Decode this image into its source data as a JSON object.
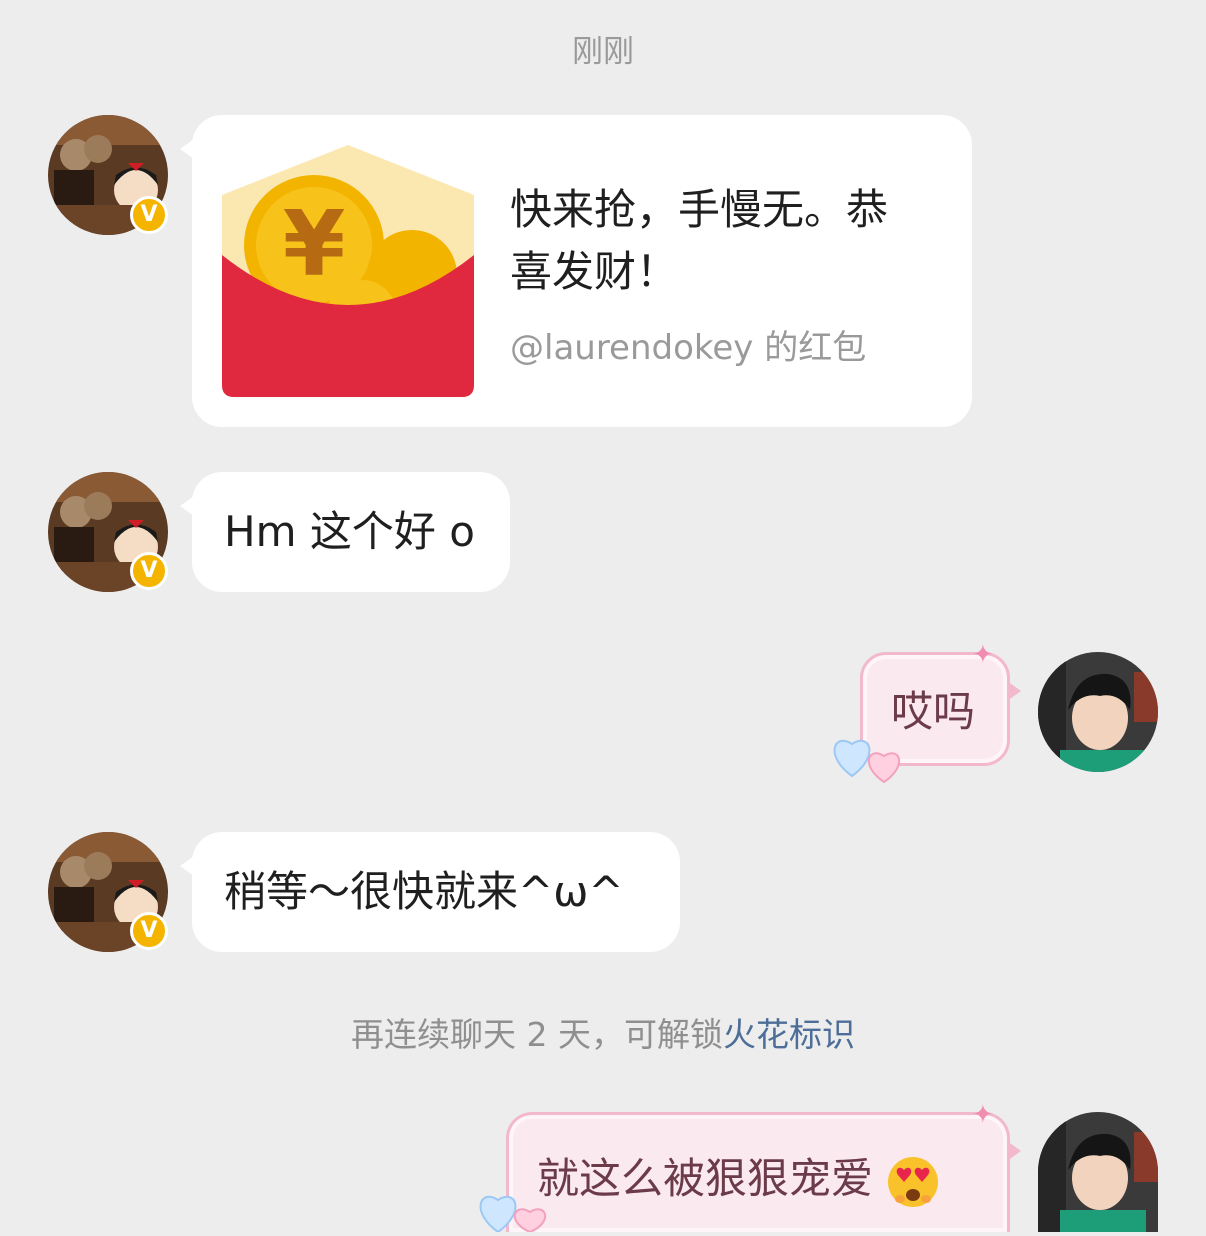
{
  "timestamp": "刚刚",
  "messages": [
    {
      "type": "red_packet",
      "title": "快来抢，手慢无。恭喜发财！",
      "title_line1": "快来抢，手慢无。恭",
      "title_line2": "喜发财！",
      "subtitle": "@laurendokey 的红包",
      "icon": "red-envelope-icon"
    },
    {
      "type": "text",
      "side": "left",
      "text": "Hm 这个好 o"
    },
    {
      "type": "text",
      "side": "right",
      "text": "哎吗"
    },
    {
      "type": "text",
      "side": "left",
      "text": "稍等～很快就来^ω^"
    },
    {
      "type": "text",
      "side": "right",
      "text": "就这么被狠狠宠爱",
      "emoji": "heart-eyes-face-icon"
    }
  ],
  "system_notice": {
    "text": "再连续聊天 2 天，可解锁",
    "link": "火花标识"
  },
  "badges": {
    "verified": "V"
  },
  "colors": {
    "background": "#ededed",
    "bubble": "#ffffff",
    "verified_badge": "#f5b400",
    "red_packet": "#e0283f",
    "coin": "#f7c21a",
    "pink_bubble": "#fbe9f0",
    "link": "#4d6e98"
  }
}
